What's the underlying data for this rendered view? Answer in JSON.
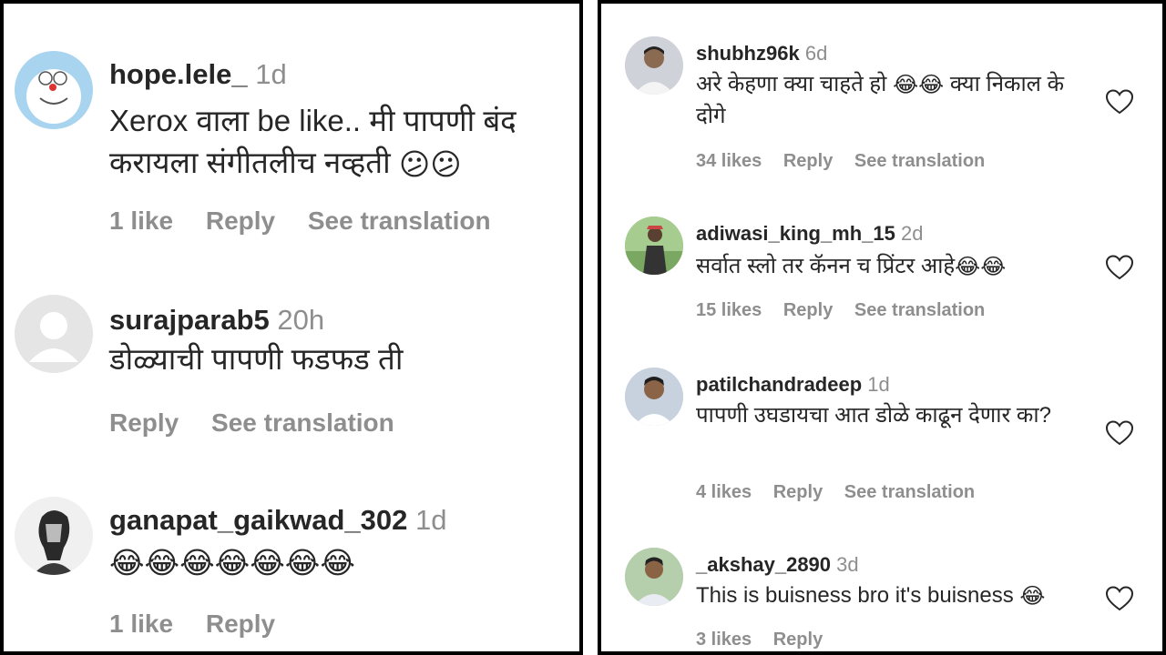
{
  "left": {
    "comments": [
      {
        "username": "hope.lele_",
        "time": "1d",
        "text": "Xerox वाला be like.. मी पापणी बंद करायला संगीतलीच नव्हती",
        "emojis": "😕😕",
        "likes": "1 like",
        "reply": "Reply",
        "translate": "See translation"
      },
      {
        "username": "surajparab5",
        "time": "20h",
        "text": "डोळ्याची पापणी फडफड ती",
        "likes": "",
        "reply": "Reply",
        "translate": "See translation"
      },
      {
        "username": "ganapat_gaikwad_302",
        "time": "1d",
        "text": "",
        "emojis": "😂😂😂😂😂😂😂",
        "likes": "1 like",
        "reply": "Reply",
        "translate": ""
      }
    ]
  },
  "right": {
    "comments": [
      {
        "username": "shubhz96k",
        "time": "6d",
        "text_a": "अरे केहणा क्या चाहते हो",
        "emojis": "😂😂",
        "text_b": "क्या निकाल के दोगे",
        "likes": "34 likes",
        "reply": "Reply",
        "translate": "See translation"
      },
      {
        "username": "adiwasi_king_mh_15",
        "time": "2d",
        "text": "सर्वात स्लो तर कॅनन च प्रिंटर आहे",
        "emojis": "😂😂",
        "likes": "15 likes",
        "reply": "Reply",
        "translate": "See translation"
      },
      {
        "username": "patilchandradeep",
        "time": "1d",
        "text": "पापणी उघडायचा आत डोळे काढून देणार का?",
        "likes": "4 likes",
        "reply": "Reply",
        "translate": "See translation"
      },
      {
        "username": "_akshay_2890",
        "time": "3d",
        "text": "This is buisness bro it's buisness",
        "emojis": "😂",
        "likes": "3 likes",
        "reply": "Reply",
        "translate": ""
      }
    ]
  },
  "colors": {
    "text": "#262626",
    "muted": "#8e8e8e",
    "border": "#000000",
    "heart": "#262626"
  },
  "icons": [
    "heart-icon",
    "avatar"
  ]
}
